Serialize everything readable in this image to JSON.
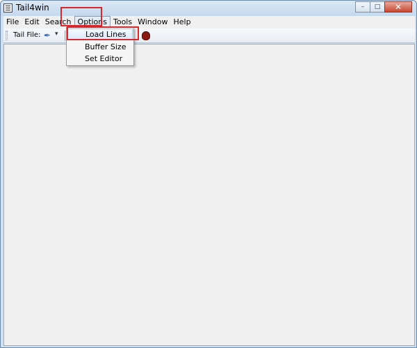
{
  "window": {
    "title": "Tail4win",
    "controls": {
      "minimize": "–",
      "maximize": "□",
      "close": "✕"
    }
  },
  "menubar": {
    "items": [
      "File",
      "Edit",
      "Search",
      "Options",
      "Tools",
      "Window",
      "Help"
    ],
    "active": "Options"
  },
  "toolbar": {
    "tail_file_label": "Tail File:",
    "tail_icon": "feather-icon",
    "dropdown_icon": "▾",
    "bug_icon": "bug-icon"
  },
  "options_menu": {
    "items": [
      "Load Lines",
      "Buffer Size",
      "Set Editor"
    ],
    "highlighted": "Load Lines"
  },
  "colors": {
    "highlight_box": "#d7262c",
    "menu_highlight": "#d9e8fb"
  }
}
